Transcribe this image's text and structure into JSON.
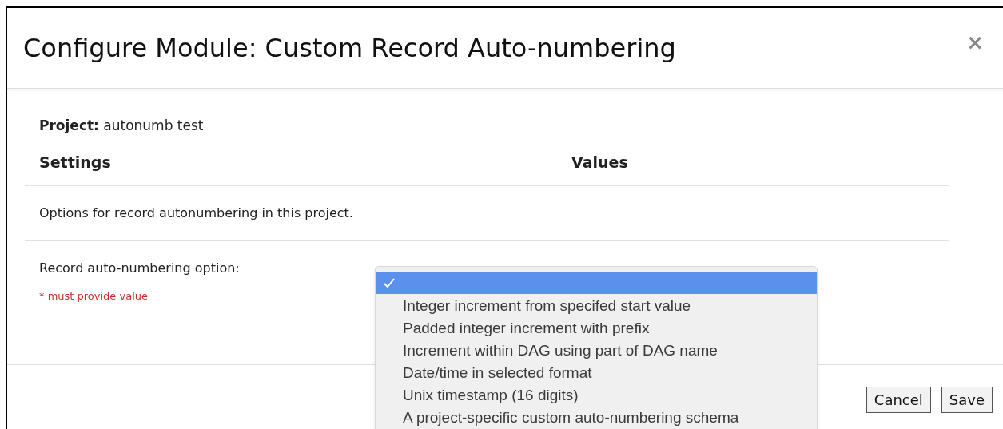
{
  "dialog": {
    "title": "Configure Module: Custom Record Auto-numbering",
    "close": "×"
  },
  "project": {
    "label": "Project:",
    "value": "autonumb test"
  },
  "table": {
    "columns": [
      "Settings",
      "Values"
    ]
  },
  "description": "Options for record autonumbering in this project.",
  "field": {
    "label": "Record auto-numbering option:",
    "required_note": "* must provide value"
  },
  "dropdown": {
    "options": [
      {
        "selected": true
      },
      {
        "label": "Integer increment from specifed start value",
        "selected": false
      },
      {
        "label": "Padded integer increment with prefix",
        "selected": false
      },
      {
        "label": "Increment within DAG using part of DAG name",
        "selected": false
      },
      {
        "label": "Date/time in selected format",
        "selected": false
      },
      {
        "label": "Unix timestamp (16 digits)",
        "selected": false
      },
      {
        "label": "A project-specific custom auto-numbering schema",
        "selected": false
      }
    ]
  },
  "buttons": [
    "Cancel",
    "Save"
  ]
}
